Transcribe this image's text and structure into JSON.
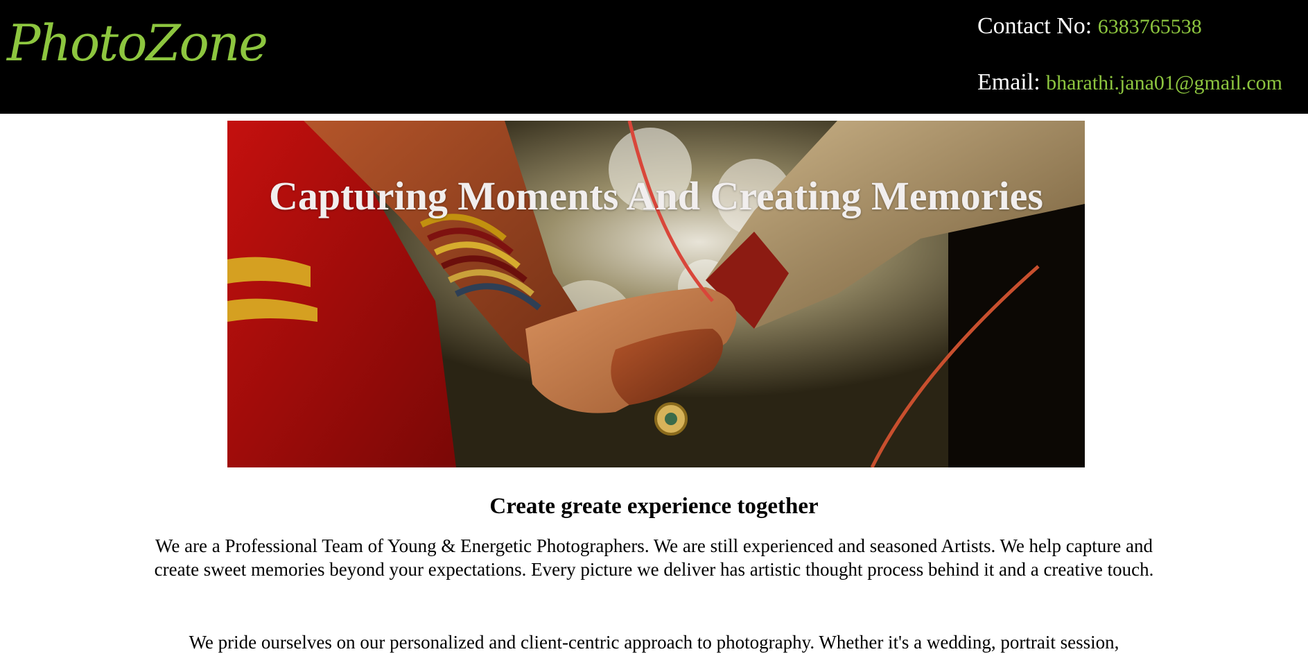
{
  "header": {
    "logo": "PhotoZone",
    "phone_label": "Contact No:",
    "phone_value": "6383765538",
    "email_label": "Email:",
    "email_value": "bharathi.jana01@gmail.com"
  },
  "hero": {
    "title": "Capturing Moments And Creating Memories"
  },
  "about": {
    "heading": "Create greate experience together",
    "paragraph_1": "We are a Professional Team of Young & Energetic Photographers. We are still experienced and seasoned Artists. We help capture and create sweet memories beyond your expectations. Every picture we deliver has artistic thought process behind it and a creative touch.",
    "paragraph_2": "We pride ourselves on our personalized and client-centric approach to photography. Whether it's a wedding, portrait session,"
  },
  "colors": {
    "accent": "#8dc63f",
    "header_bg": "#000000"
  }
}
